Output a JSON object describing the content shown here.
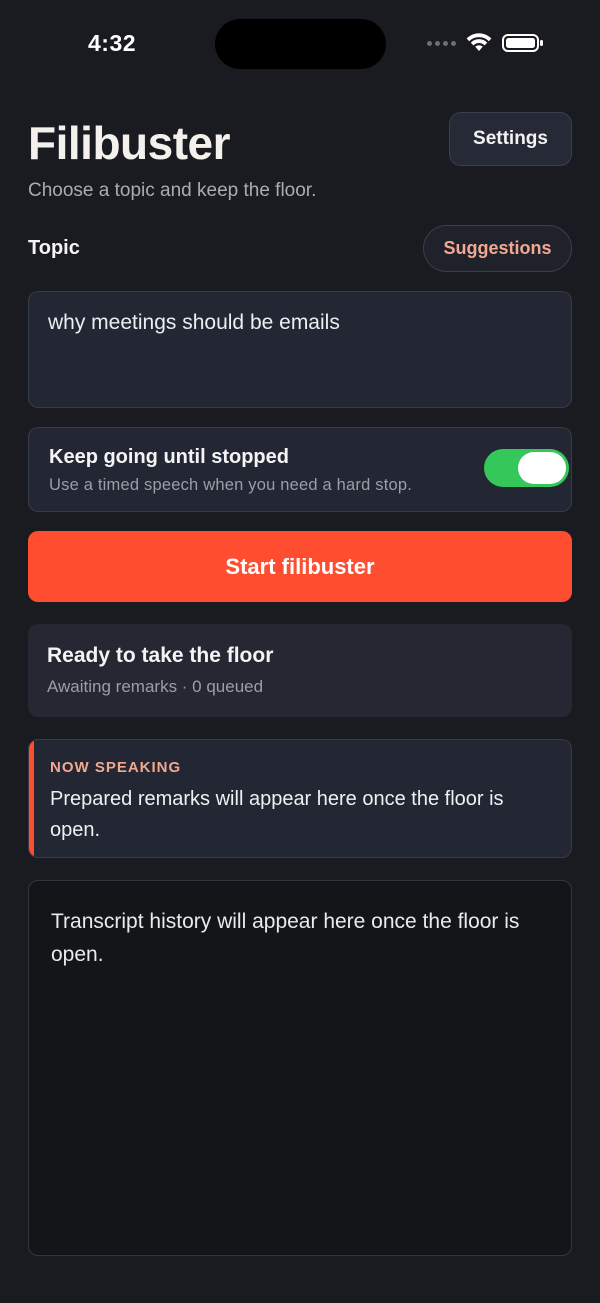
{
  "status_bar": {
    "time": "4:32",
    "icons": [
      "signal-dots-icon",
      "wifi-icon",
      "battery-icon"
    ]
  },
  "header": {
    "title": "Filibuster",
    "settings_label": "Settings",
    "subtitle": "Choose a topic and keep the floor."
  },
  "topic": {
    "label": "Topic",
    "suggestions_label": "Suggestions",
    "value": "why meetings should be emails"
  },
  "keep_going": {
    "title": "Keep going until stopped",
    "hint": "Use a timed speech when you need a hard stop.",
    "enabled": true
  },
  "start_button": {
    "label": "Start filibuster"
  },
  "status": {
    "title": "Ready to take the floor",
    "subtitle": "Awaiting remarks · 0 queued"
  },
  "now_speaking": {
    "label": "NOW SPEAKING",
    "text": "Prepared remarks will appear here once the floor is open."
  },
  "transcript": {
    "placeholder": "Transcript history will appear here once the floor is open."
  },
  "colors": {
    "accent": "#ff4d30",
    "accent_text": "#f2a890",
    "toggle_on": "#34c759",
    "background": "#1a1b20",
    "card": "#232733"
  }
}
